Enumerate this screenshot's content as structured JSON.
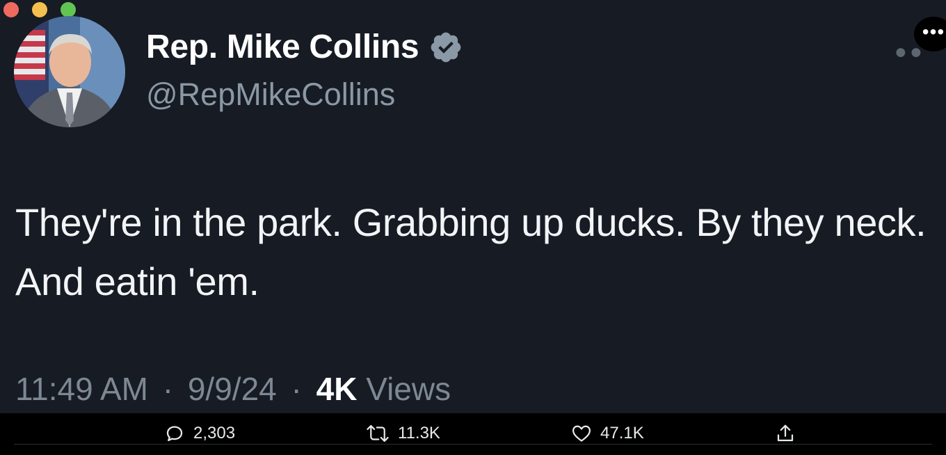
{
  "window": {
    "controls": [
      "close",
      "minimize",
      "zoom"
    ]
  },
  "tweet": {
    "author_name": "Rep. Mike Collins",
    "handle": "@RepMikeCollins",
    "verified": true,
    "text": "They're in the park. Grabbing up ducks. By they neck. And eatin 'em.",
    "time": "11:49 AM",
    "date": "9/9/24",
    "separator": "·",
    "views_count": "4K",
    "views_label": "Views"
  },
  "actions": {
    "replies": "2,303",
    "retweets": "11.3K",
    "likes": "47.1K"
  },
  "icons": {
    "more": "more-horizontal-icon",
    "verified": "verified-badge-icon",
    "reply": "reply-icon",
    "retweet": "retweet-icon",
    "like": "heart-icon",
    "share": "share-icon"
  },
  "colors": {
    "background": "#161b24",
    "text": "#f2f4f6",
    "muted": "#7d8893",
    "verified_badge": "#8b98a5",
    "action_bar": "#000000"
  }
}
